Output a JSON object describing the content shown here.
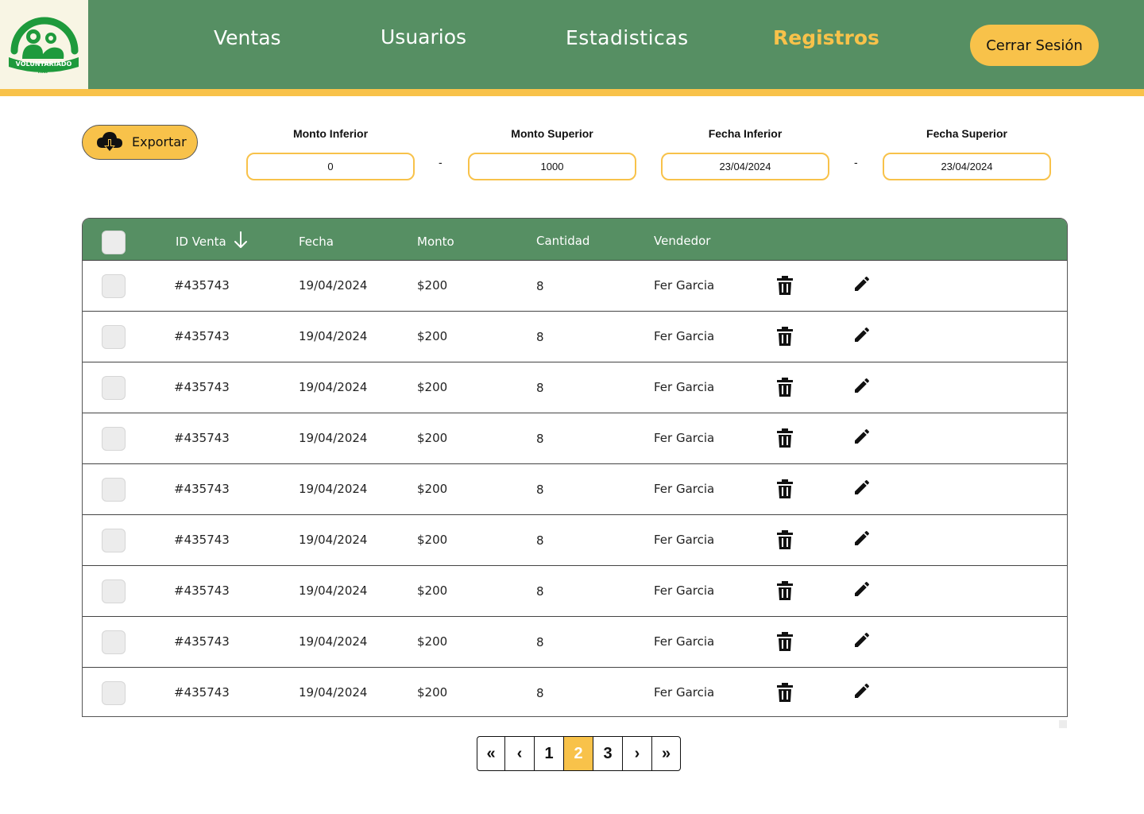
{
  "brand": {
    "logo_text": "VOLUNTARIADO",
    "logo_subtext": "HNP"
  },
  "nav": {
    "items": [
      {
        "label": "Ventas"
      },
      {
        "label": "Usuarios"
      },
      {
        "label": "Estadisticas"
      },
      {
        "label": "Registros"
      }
    ],
    "active": "Registros",
    "logout_label": "Cerrar Sesión"
  },
  "toolbar": {
    "export_label": "Exportar",
    "export_icon": "cloud-download-icon"
  },
  "filters": {
    "monto_inferior": {
      "label": "Monto Inferior",
      "value": "0"
    },
    "monto_superior": {
      "label": "Monto Superior",
      "value": "1000"
    },
    "fecha_inferior": {
      "label": "Fecha Inferior",
      "value": "23/04/2024"
    },
    "fecha_superior": {
      "label": "Fecha Superior",
      "value": "23/04/2024"
    },
    "separator": "-"
  },
  "table": {
    "columns": [
      "ID Venta",
      "Fecha",
      "Monto",
      "Cantidad",
      "Vendedor"
    ],
    "sort_icon": "arrow-down-icon",
    "rows": [
      {
        "id": "#435743",
        "fecha": "19/04/2024",
        "monto": "$200",
        "cantidad": "8",
        "vendedor": "Fer Garcia"
      },
      {
        "id": "#435743",
        "fecha": "19/04/2024",
        "monto": "$200",
        "cantidad": "8",
        "vendedor": "Fer Garcia"
      },
      {
        "id": "#435743",
        "fecha": "19/04/2024",
        "monto": "$200",
        "cantidad": "8",
        "vendedor": "Fer Garcia"
      },
      {
        "id": "#435743",
        "fecha": "19/04/2024",
        "monto": "$200",
        "cantidad": "8",
        "vendedor": "Fer Garcia"
      },
      {
        "id": "#435743",
        "fecha": "19/04/2024",
        "monto": "$200",
        "cantidad": "8",
        "vendedor": "Fer Garcia"
      },
      {
        "id": "#435743",
        "fecha": "19/04/2024",
        "monto": "$200",
        "cantidad": "8",
        "vendedor": "Fer Garcia"
      },
      {
        "id": "#435743",
        "fecha": "19/04/2024",
        "monto": "$200",
        "cantidad": "8",
        "vendedor": "Fer Garcia"
      },
      {
        "id": "#435743",
        "fecha": "19/04/2024",
        "monto": "$200",
        "cantidad": "8",
        "vendedor": "Fer Garcia"
      },
      {
        "id": "#435743",
        "fecha": "19/04/2024",
        "monto": "$200",
        "cantidad": "8",
        "vendedor": "Fer Garcia"
      }
    ]
  },
  "pagination": {
    "first": "«",
    "prev": "‹",
    "pages": [
      "1",
      "2",
      "3"
    ],
    "current": "2",
    "next": "›",
    "last": "»"
  },
  "colors": {
    "primary_green": "#568f63",
    "accent_yellow": "#f8c24a",
    "logo_bg": "#f8f5e4"
  }
}
